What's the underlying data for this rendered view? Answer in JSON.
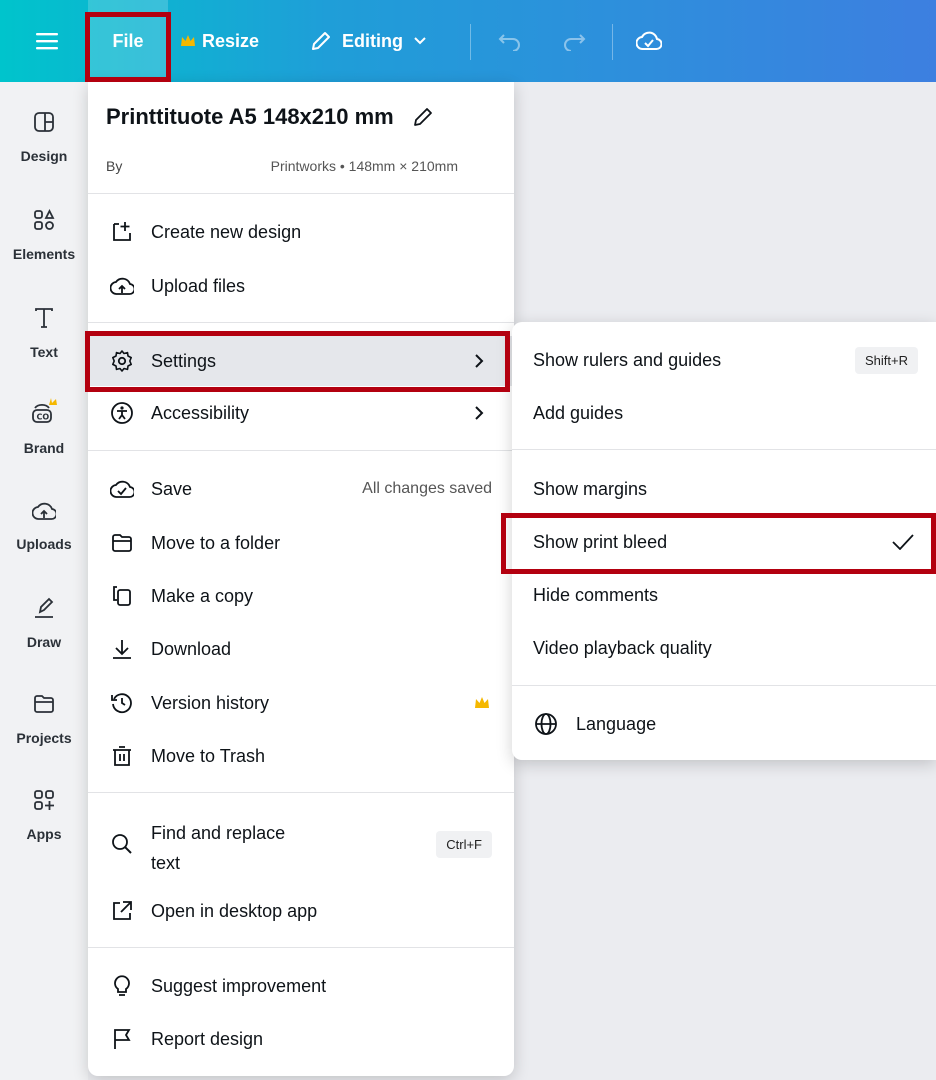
{
  "topbar": {
    "menu_icon": "hamburger-icon",
    "file_label": "File",
    "resize_label": "Resize",
    "editing_label": "Editing",
    "crown_color": "#f5b800"
  },
  "sidebar": {
    "items": [
      {
        "label": "Design",
        "icon": "layout-icon"
      },
      {
        "label": "Elements",
        "icon": "shapes-icon"
      },
      {
        "label": "Text",
        "icon": "text-icon"
      },
      {
        "label": "Brand",
        "icon": "brand-icon"
      },
      {
        "label": "Uploads",
        "icon": "upload-cloud-icon"
      },
      {
        "label": "Draw",
        "icon": "draw-icon"
      },
      {
        "label": "Projects",
        "icon": "folder-icon"
      },
      {
        "label": "Apps",
        "icon": "apps-icon"
      }
    ]
  },
  "file_menu": {
    "title": "Printtituote A5 148x210 mm",
    "by": "By",
    "author": "Printworks • 148mm × 210mm",
    "items": [
      {
        "label": "Create new design",
        "icon": "add-design-icon"
      },
      {
        "label": "Upload files",
        "icon": "upload-cloud-icon"
      },
      {
        "label": "Settings",
        "icon": "gear-icon"
      },
      {
        "label": "Accessibility",
        "icon": "accessibility-icon"
      },
      {
        "label": "Save",
        "icon": "cloud-check-icon",
        "right": "All changes saved"
      },
      {
        "label": "Move to a folder",
        "icon": "folder-icon"
      },
      {
        "label": "Make a copy",
        "icon": "copy-icon"
      },
      {
        "label": "Download",
        "icon": "download-icon"
      },
      {
        "label": "Version history",
        "icon": "history-icon"
      },
      {
        "label": "Move to Trash",
        "icon": "trash-icon"
      },
      {
        "label": "Find and replace",
        "label2": "text",
        "icon": "search-icon",
        "shortcut": "Ctrl+F"
      },
      {
        "label": "Open in desktop app",
        "icon": "external-link-icon"
      },
      {
        "label": "Suggest improvement",
        "icon": "lightbulb-icon"
      },
      {
        "label": "Report design",
        "icon": "flag-icon"
      }
    ]
  },
  "settings_menu": {
    "items": [
      {
        "label": "Show rulers and guides",
        "shortcut": "Shift+R"
      },
      {
        "label": "Add guides"
      },
      {
        "label": "Show margins"
      },
      {
        "label": "Show print bleed",
        "checked": true
      },
      {
        "label": "Hide comments"
      },
      {
        "label": "Video playback quality"
      },
      {
        "label": "Language",
        "icon": "globe-icon"
      }
    ]
  },
  "colors": {
    "highlight": "#b3000f",
    "topbar_start": "#00c4cc",
    "topbar_end": "#3d7fe0"
  }
}
